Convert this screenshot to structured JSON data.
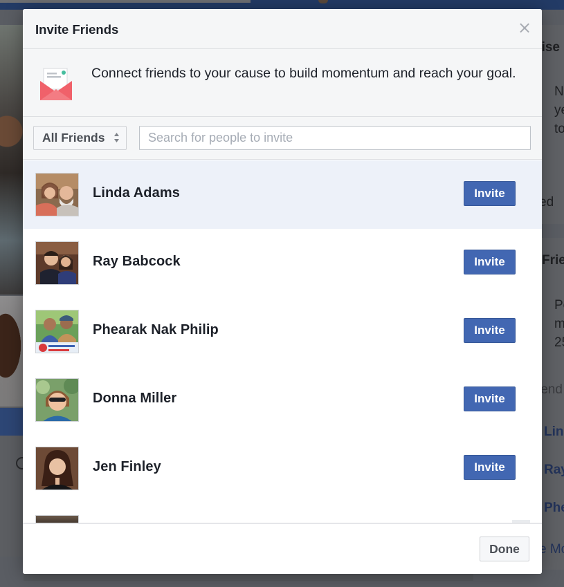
{
  "background": {
    "right_column": [
      {
        "text": "aise",
        "style": "bold"
      },
      {
        "text": "N"
      },
      {
        "text": "ye"
      },
      {
        "text": "to"
      },
      {
        "text": "ed"
      },
      {
        "text": "Frie",
        "style": "bold"
      },
      {
        "text": "Pe"
      },
      {
        "text": "m"
      },
      {
        "text": "25"
      },
      {
        "text": "iend"
      },
      {
        "text": "Lin",
        "style": "link"
      },
      {
        "text": "Ray",
        "style": "link"
      },
      {
        "text": "Phe",
        "style": "link"
      },
      {
        "text": "e Mo"
      }
    ]
  },
  "dialog": {
    "title": "Invite Friends",
    "close_icon": "close-icon",
    "intro": {
      "icon": "envelope-icon",
      "text": "Connect friends to your cause to build momentum and reach your goal."
    },
    "filter": {
      "selected": "All Friends",
      "icon": "sort-arrows-icon"
    },
    "search": {
      "placeholder": "Search for people to invite",
      "value": ""
    },
    "friends": [
      {
        "name": "Linda Adams",
        "button": "Invite",
        "highlighted": true
      },
      {
        "name": "Ray Babcock",
        "button": "Invite",
        "highlighted": false
      },
      {
        "name": "Phearak Nak Philip",
        "button": "Invite",
        "highlighted": false
      },
      {
        "name": "Donna Miller",
        "button": "Invite",
        "highlighted": false
      },
      {
        "name": "Jen Finley",
        "button": "Invite",
        "highlighted": false
      }
    ],
    "done_label": "Done"
  },
  "colors": {
    "accent": "#4267b2",
    "highlight_row": "#edf1f9",
    "header_bg": "#f5f6f7",
    "overlay": "#5a5d63"
  }
}
